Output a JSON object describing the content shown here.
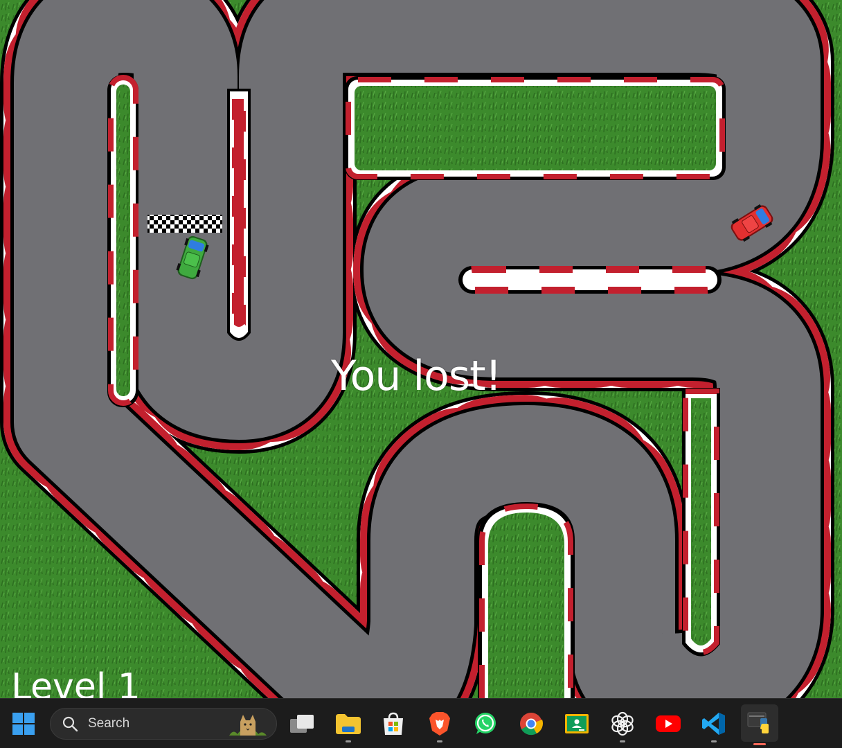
{
  "game": {
    "message": "You lost!",
    "level_label": "Level 1",
    "colors": {
      "grass": "#3c8a2c",
      "asphalt": "#707074",
      "curb_red": "#c3202e",
      "curb_white": "#ffffff",
      "outline": "#000000"
    },
    "cars": [
      {
        "name": "player-car",
        "color": "green"
      },
      {
        "name": "opponent-car",
        "color": "red"
      }
    ]
  },
  "taskbar": {
    "search_placeholder": "Search",
    "apps": [
      {
        "id": "start",
        "icon": "windows-start-icon"
      },
      {
        "id": "task-view",
        "icon": "task-view-icon"
      },
      {
        "id": "file-explorer",
        "icon": "folder-icon",
        "open": true
      },
      {
        "id": "store",
        "icon": "microsoft-store-icon"
      },
      {
        "id": "brave",
        "icon": "brave-browser-icon",
        "open": true
      },
      {
        "id": "whatsapp",
        "icon": "whatsapp-icon"
      },
      {
        "id": "chrome",
        "icon": "chrome-icon"
      },
      {
        "id": "classroom",
        "icon": "google-classroom-icon"
      },
      {
        "id": "chatgpt",
        "icon": "chatgpt-icon",
        "open": true
      },
      {
        "id": "youtube",
        "icon": "youtube-icon"
      },
      {
        "id": "vscode",
        "icon": "vscode-icon",
        "open": true
      },
      {
        "id": "python",
        "icon": "python-icon",
        "open": true,
        "active": true
      }
    ]
  }
}
